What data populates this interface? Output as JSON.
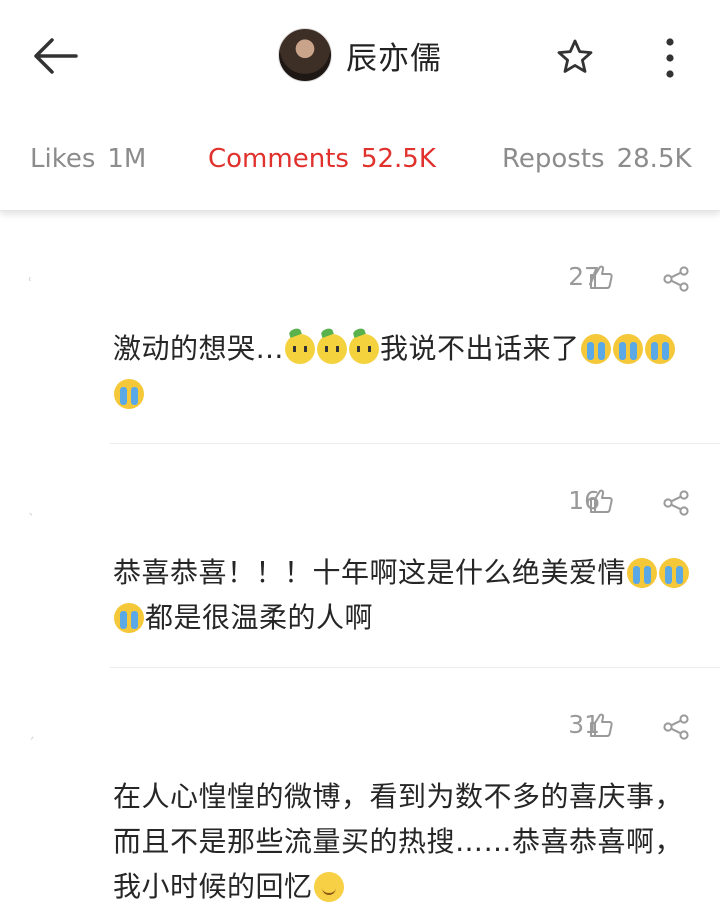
{
  "header": {
    "title": "辰亦儒",
    "back_icon": "arrow-left-icon",
    "favorite_icon": "star-outline-icon",
    "more_icon": "more-vertical-icon"
  },
  "tabs": [
    {
      "label": "Likes",
      "count": "1M",
      "active": false
    },
    {
      "label": "Comments",
      "count": "52.5K",
      "active": true
    },
    {
      "label": "Reposts",
      "count": "28.5K",
      "active": false
    }
  ],
  "colors": {
    "accent": "#e0312d",
    "muted": "#8c8c8c"
  },
  "comments": [
    {
      "likes": "27",
      "text_a": "激动的想哭…",
      "text_b": "我说不出话来了",
      "emojis_a": [
        "lemon-face",
        "lemon-face",
        "lemon-face"
      ],
      "emojis_b": [
        "crying-face",
        "crying-face",
        "crying-face",
        "crying-face"
      ]
    },
    {
      "likes": "16",
      "text_a": "恭喜恭喜！！！十年啊这是什么绝美爱情",
      "text_b": "都是很温柔的人啊",
      "emojis_a": [
        "crying-face",
        "crying-face",
        "crying-face"
      ]
    },
    {
      "likes": "31",
      "text_a": "在人心惶惶的微博，看到为数不多的喜庆事，而且不是那些流量买的热搜……恭喜恭喜啊，我小时候的回忆",
      "emojis_a": [
        "smiling-face"
      ]
    }
  ]
}
